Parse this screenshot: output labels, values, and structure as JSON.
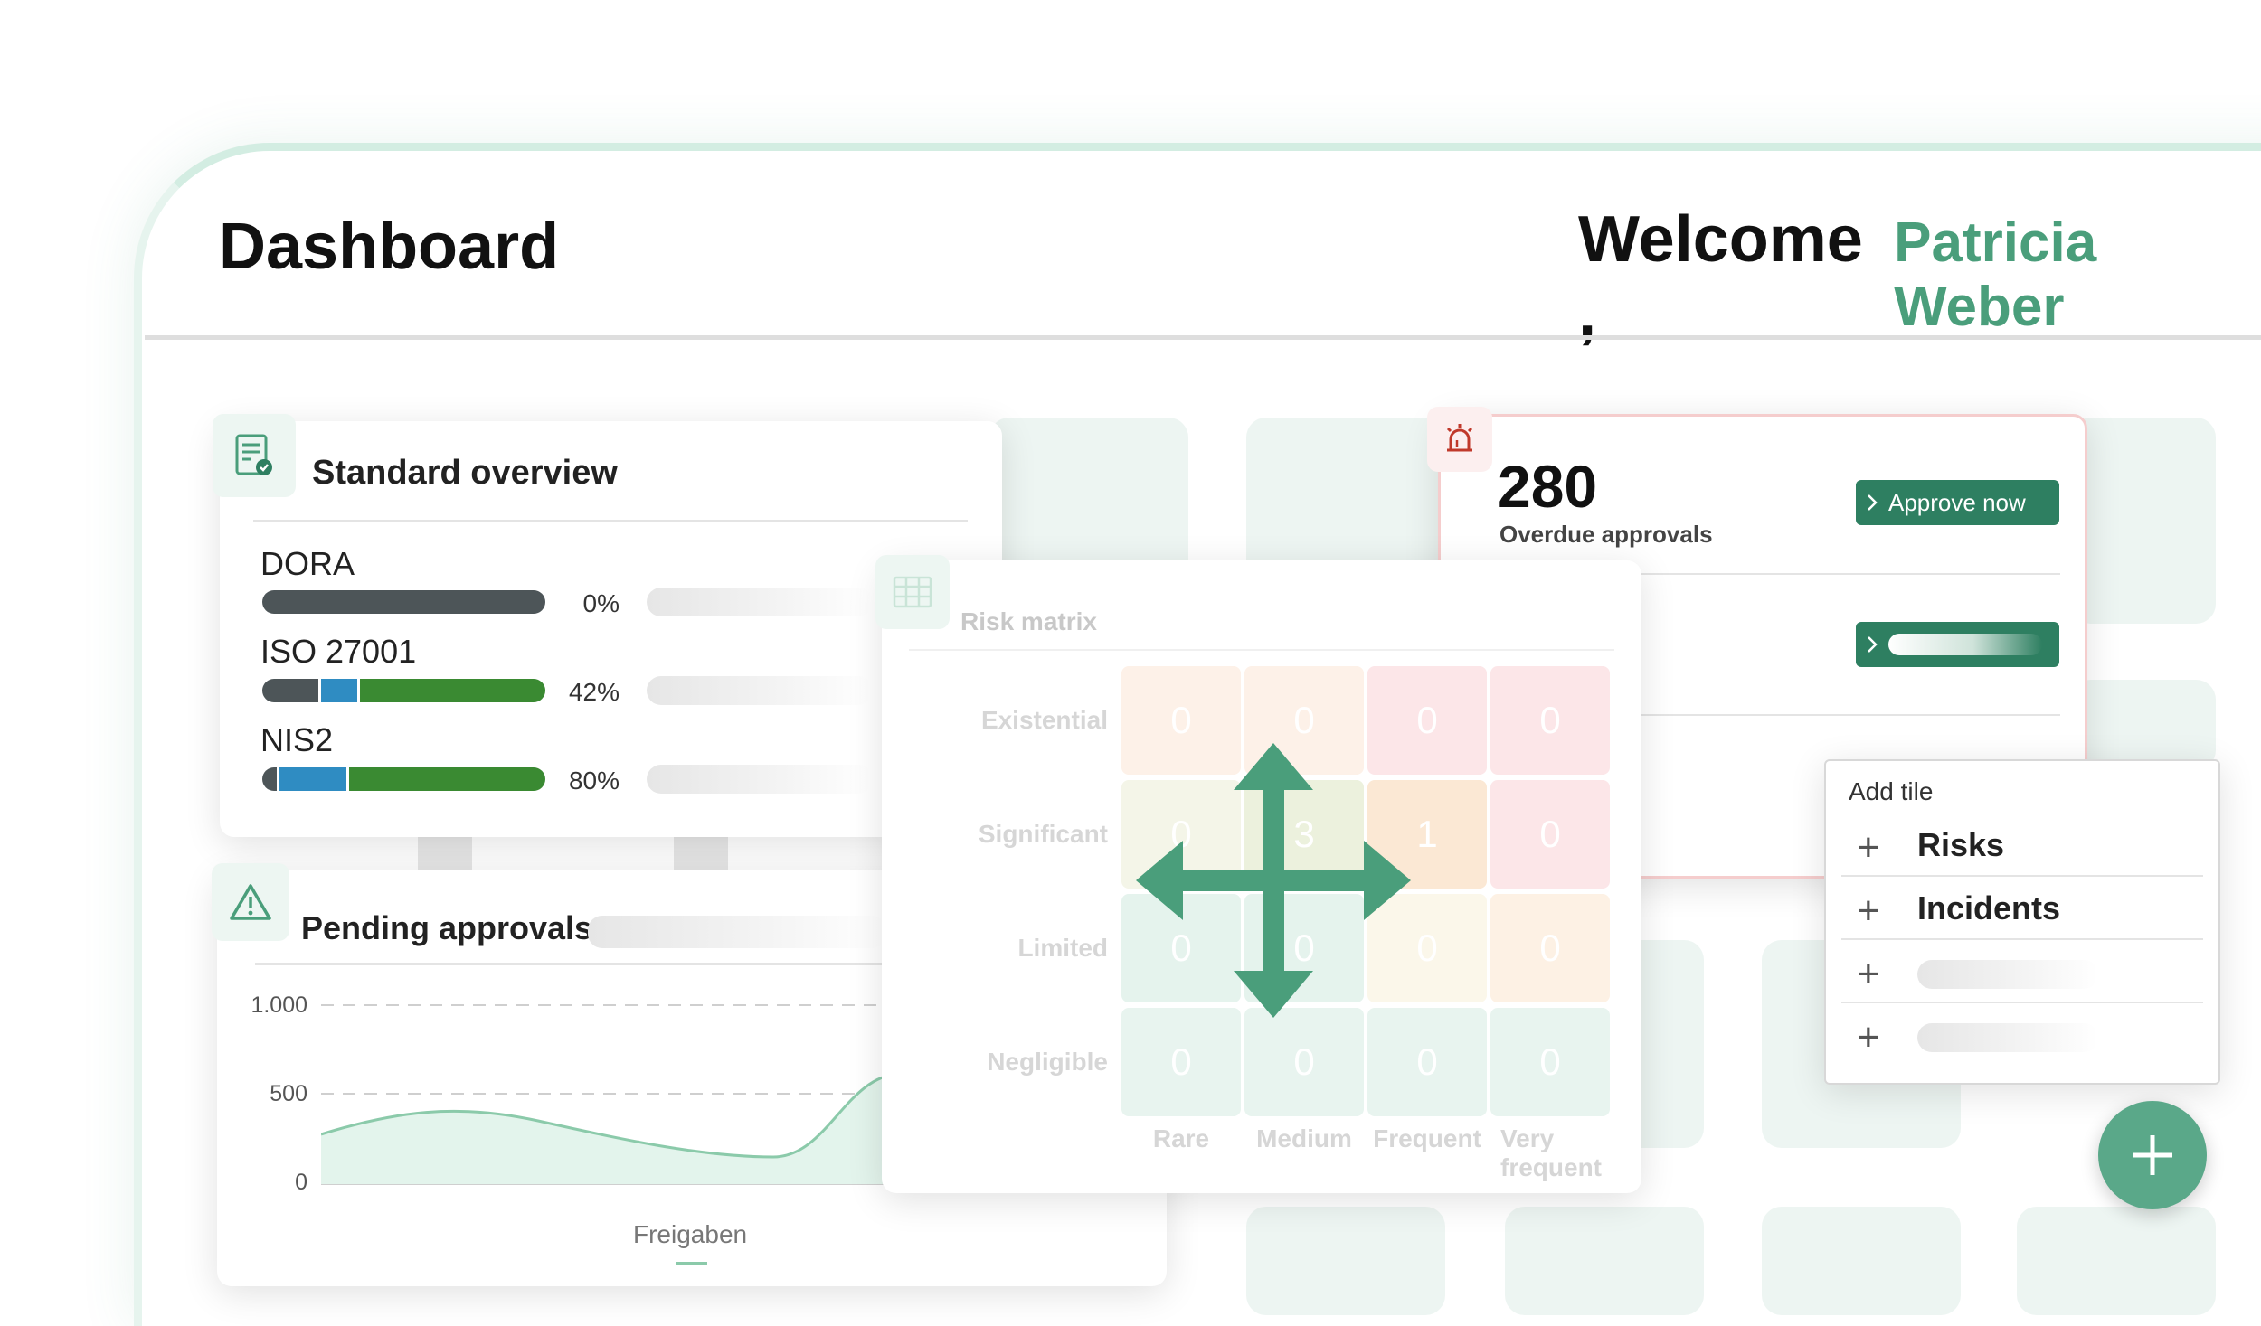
{
  "header": {
    "title": "Dashboard",
    "welcome": "Welcome ,",
    "user_name": "Patricia Weber"
  },
  "standard_overview": {
    "title": "Standard overview",
    "icon": "certificate-icon",
    "items": [
      {
        "name": "DORA",
        "percent_label": "0%",
        "progress": 0.0
      },
      {
        "name": "ISO 27001",
        "percent_label": "42%",
        "progress": 0.42
      },
      {
        "name": "NIS2",
        "percent_label": "80%",
        "progress": 0.8
      }
    ]
  },
  "pending_approvals": {
    "title": "Pending approvals:",
    "icon": "warning-triangle-icon",
    "y_ticks": [
      "1.000",
      "500",
      "0"
    ],
    "series_label": "Freigaben"
  },
  "overdue": {
    "icon": "alarm-siren-icon",
    "count": "280",
    "label": "Overdue approvals",
    "approve_label": "Approve now",
    "chevron_icon": "chevron-right-icon"
  },
  "risk_matrix": {
    "title": "Risk matrix",
    "icon": "table-grid-icon",
    "rows": [
      "Existential",
      "Significant",
      "Limited",
      "Negligible"
    ],
    "cols": [
      "Rare",
      "Medium",
      "Frequent",
      "Very frequent"
    ],
    "values": [
      [
        "0",
        "0",
        "0",
        "0"
      ],
      [
        "0",
        "3",
        "1",
        "0"
      ],
      [
        "0",
        "0",
        "0",
        "0"
      ],
      [
        "0",
        "0",
        "0",
        "0"
      ]
    ],
    "move_icon": "move-arrows-icon"
  },
  "add_tile": {
    "title": "Add tile",
    "items": [
      "Risks",
      "Incidents",
      "",
      ""
    ],
    "plus_icon": "plus-icon"
  },
  "fab": {
    "icon": "plus-icon"
  },
  "colors": {
    "brand_green": "#4a9e7b",
    "dark_green": "#2e7f61",
    "progress_green": "#3a8a32",
    "progress_blue": "#2f8cc2",
    "progress_gray": "#4d5558",
    "alert_red": "#c0392b"
  }
}
